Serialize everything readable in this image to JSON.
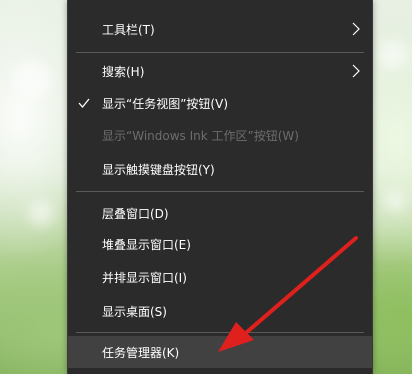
{
  "context_menu": {
    "items": [
      {
        "label": "工具栏(T)",
        "has_submenu": true,
        "checked": false,
        "enabled": true
      },
      {
        "label": "搜索(H)",
        "has_submenu": true,
        "checked": false,
        "enabled": true
      },
      {
        "label": "显示“任务视图”按钮(V)",
        "has_submenu": false,
        "checked": true,
        "enabled": true
      },
      {
        "label": "显示“Windows Ink 工作区”按钮(W)",
        "has_submenu": false,
        "checked": false,
        "enabled": false
      },
      {
        "label": "显示触摸键盘按钮(Y)",
        "has_submenu": false,
        "checked": false,
        "enabled": true
      },
      {
        "label": "层叠窗口(D)",
        "has_submenu": false,
        "checked": false,
        "enabled": true
      },
      {
        "label": "堆叠显示窗口(E)",
        "has_submenu": false,
        "checked": false,
        "enabled": true
      },
      {
        "label": "并排显示窗口(I)",
        "has_submenu": false,
        "checked": false,
        "enabled": true
      },
      {
        "label": "显示桌面(S)",
        "has_submenu": false,
        "checked": false,
        "enabled": true
      },
      {
        "label": "任务管理器(K)",
        "has_submenu": false,
        "checked": false,
        "enabled": true,
        "highlighted": true
      }
    ]
  },
  "colors": {
    "menu_bg": "#2b2b2b",
    "text": "#ffffff",
    "disabled_text": "#6d6d6d",
    "separator": "#5a5a5a",
    "highlight": "#414141",
    "annotation_arrow": "#e0201c"
  },
  "icons": {
    "submenu": "chevron-right-icon",
    "check": "checkmark-icon"
  }
}
